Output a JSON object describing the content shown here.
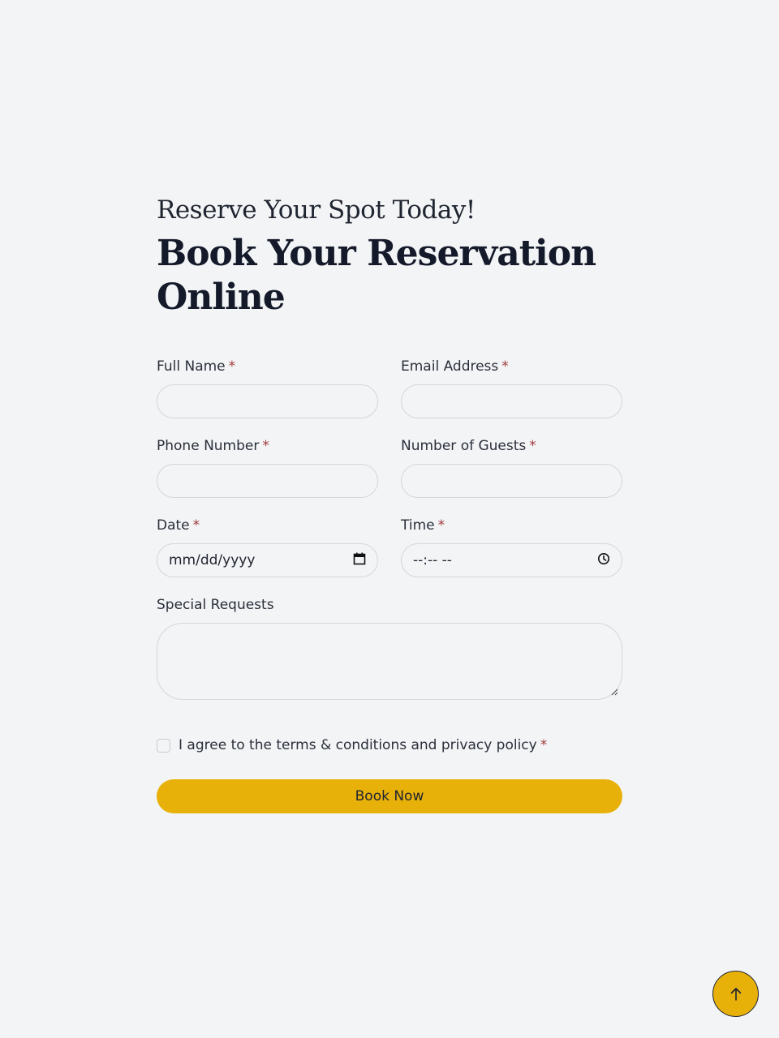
{
  "header": {
    "eyebrow": "Reserve Your Spot Today!",
    "title": "Book Your Reservation Online"
  },
  "form": {
    "required_mark": "*",
    "fields": {
      "full_name": {
        "label": "Full Name",
        "value": ""
      },
      "email": {
        "label": "Email Address",
        "value": ""
      },
      "phone": {
        "label": "Phone Number",
        "value": ""
      },
      "guests": {
        "label": "Number of Guests",
        "value": ""
      },
      "date": {
        "label": "Date",
        "placeholder": "mm/dd/yyyy",
        "icon": "calendar-icon"
      },
      "time": {
        "label": "Time",
        "placeholder": "--:-- --",
        "icon": "clock-icon"
      },
      "special_requests": {
        "label": "Special Requests",
        "value": ""
      }
    },
    "agree_text": "I agree to the terms & conditions and privacy policy",
    "submit_label": "Book Now"
  },
  "scroll_top": {
    "icon": "arrow-up-icon"
  },
  "colors": {
    "accent": "#e8b10a",
    "background": "#f3f4f6",
    "required": "#a03a3a",
    "heading": "#141a2a"
  }
}
